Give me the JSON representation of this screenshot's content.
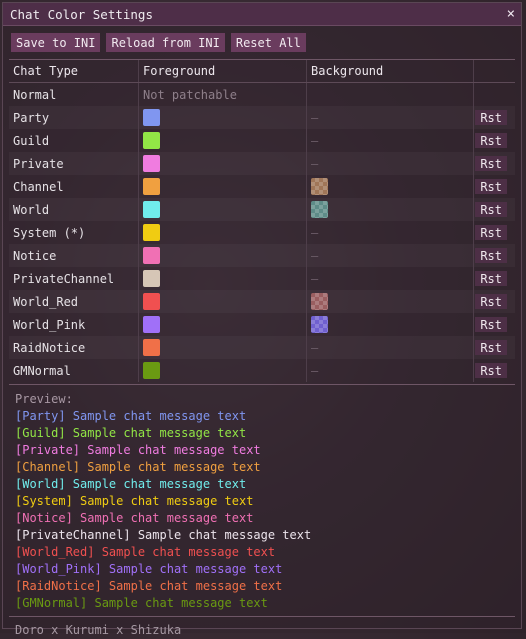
{
  "window": {
    "title": "Chat Color Settings",
    "close_glyph": "×"
  },
  "toolbar": {
    "save": "Save to INI",
    "reload": "Reload from INI",
    "reset": "Reset All"
  },
  "table": {
    "headers": {
      "type": "Chat Type",
      "foreground": "Foreground",
      "background": "Background"
    },
    "rows": [
      {
        "type": "Normal",
        "fg_text": "Not patchable"
      },
      {
        "type": "Party",
        "fg": "#8096f0",
        "bg": "–",
        "reset": "Rst"
      },
      {
        "type": "Guild",
        "fg": "#92e646",
        "bg": "–",
        "reset": "Rst"
      },
      {
        "type": "Private",
        "fg": "#f07ce0",
        "bg": "–",
        "reset": "Rst"
      },
      {
        "type": "Channel",
        "fg": "#f0a040",
        "bg_color": "#a07658",
        "reset": "Rst"
      },
      {
        "type": "World",
        "fg": "#70ecec",
        "bg_color": "#5e8c88",
        "reset": "Rst"
      },
      {
        "type": "System (*)",
        "fg": "#f0cc12",
        "bg": "–",
        "reset": "Rst"
      },
      {
        "type": "Notice",
        "fg": "#f070b4",
        "bg": "–",
        "reset": "Rst"
      },
      {
        "type": "PrivateChannel",
        "fg": "#d6c6b6",
        "bg": "–",
        "reset": "Rst"
      },
      {
        "type": "World_Red",
        "fg": "#f05050",
        "bg_color": "#9a5e60",
        "reset": "Rst"
      },
      {
        "type": "World_Pink",
        "fg": "#a070f8",
        "bg_color": "#7060d0",
        "reset": "Rst"
      },
      {
        "type": "RaidNotice",
        "fg": "#f07048",
        "bg": "–",
        "reset": "Rst"
      },
      {
        "type": "GMNormal",
        "fg": "#6a9a12",
        "bg": "–",
        "reset": "Rst"
      }
    ]
  },
  "preview": {
    "label": "Preview:",
    "lines": [
      {
        "text": "[Party] Sample chat message text",
        "color": "#8096f0"
      },
      {
        "text": "[Guild] Sample chat message text",
        "color": "#92e646"
      },
      {
        "text": "[Private] Sample chat message text",
        "color": "#f07ce0"
      },
      {
        "text": "[Channel] Sample chat message text",
        "color": "#f0a040"
      },
      {
        "text": "[World] Sample chat message text",
        "color": "#70ecec"
      },
      {
        "text": "[System] Sample chat message text",
        "color": "#f0cc12"
      },
      {
        "text": "[Notice] Sample chat message text",
        "color": "#f070b4"
      },
      {
        "text": "[PrivateChannel] Sample chat message text",
        "color": "#ece4ec"
      },
      {
        "text": "[World_Red] Sample chat message text",
        "color": "#f05050"
      },
      {
        "text": "[World_Pink] Sample chat message text",
        "color": "#a070f8"
      },
      {
        "text": "[RaidNotice] Sample chat message text",
        "color": "#f07048"
      },
      {
        "text": "[GMNormal] Sample chat message text",
        "color": "#6a9a12"
      }
    ]
  },
  "footer": "Doro x Kurumi x Shizuka"
}
